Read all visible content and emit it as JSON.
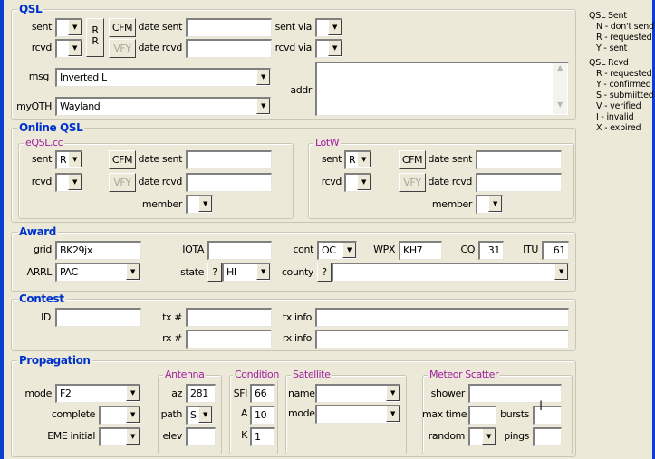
{
  "qsl": {
    "title": "QSL",
    "sent_label": "sent",
    "rcvd_label": "rcvd",
    "sent": "",
    "rcvd": "",
    "rr_label": "R\nR",
    "cfm": "CFM",
    "vfy": "VFY",
    "date_sent_label": "date sent",
    "date_rcvd_label": "date rcvd",
    "date_sent": "",
    "date_rcvd": "",
    "sent_via_label": "sent via",
    "rcvd_via_label": "rcvd via",
    "sent_via": "",
    "rcvd_via": "",
    "msg_label": "msg",
    "msg": "Inverted L",
    "myqth_label": "myQTH",
    "myqth": "Wayland",
    "addr_label": "addr",
    "addr": ""
  },
  "legend": {
    "sent_title": "QSL Sent",
    "sent_items": [
      "N - don't send",
      "R - requested",
      "Y - sent"
    ],
    "rcvd_title": "QSL Rcvd",
    "rcvd_items": [
      "R - requested",
      "Y - confirmed",
      "S - submiitted",
      "V - verified",
      "I  - invalid",
      "X - expired"
    ]
  },
  "online": {
    "title": "Online QSL",
    "eqsl": {
      "title": "eQSL.cc",
      "sent_label": "sent",
      "sent": "R",
      "rcvd_label": "rcvd",
      "rcvd": "",
      "cfm": "CFM",
      "vfy": "VFY",
      "date_sent_label": "date sent",
      "date_rcvd_label": "date rcvd",
      "member_label": "member",
      "member": ""
    },
    "lotw": {
      "title": "LotW",
      "sent_label": "sent",
      "sent": "R",
      "rcvd_label": "rcvd",
      "rcvd": "",
      "cfm": "CFM",
      "vfy": "VFY",
      "date_sent_label": "date sent",
      "date_rcvd_label": "date rcvd",
      "member_label": "member",
      "member": ""
    }
  },
  "award": {
    "title": "Award",
    "grid_label": "grid",
    "grid": "BK29jx",
    "arrl_label": "ARRL",
    "arrl": "PAC",
    "iota_label": "IOTA",
    "iota": "",
    "state_label": "state",
    "state": "HI",
    "q": "?",
    "cont_label": "cont",
    "cont": "OC",
    "wpx_label": "WPX",
    "wpx": "KH7",
    "cq_label": "CQ",
    "cq": "31",
    "itu_label": "ITU",
    "itu": "61",
    "county_label": "county",
    "county": ""
  },
  "contest": {
    "title": "Contest",
    "id_label": "ID",
    "tx_label": "tx #",
    "rx_label": "rx #",
    "txinfo_label": "tx info",
    "rxinfo_label": "rx info"
  },
  "prop": {
    "title": "Propagation",
    "mode_label": "mode",
    "mode": "F2",
    "complete_label": "complete",
    "eme_label": "EME initial",
    "antenna": {
      "title": "Antenna",
      "az_label": "az",
      "az": "281",
      "path_label": "path",
      "path": "S",
      "elev_label": "elev",
      "elev": ""
    },
    "condition": {
      "title": "Condition",
      "sfi_label": "SFI",
      "sfi": "66",
      "a_label": "A",
      "a": "10",
      "k_label": "K",
      "k": "1"
    },
    "satellite": {
      "title": "Satellite",
      "name_label": "name",
      "mode_label": "mode"
    },
    "meteor": {
      "title": "Meteor Scatter",
      "shower_label": "shower",
      "maxtime_label": "max time",
      "bursts_label": "bursts",
      "random_label": "random",
      "pings_label": "pings"
    }
  }
}
